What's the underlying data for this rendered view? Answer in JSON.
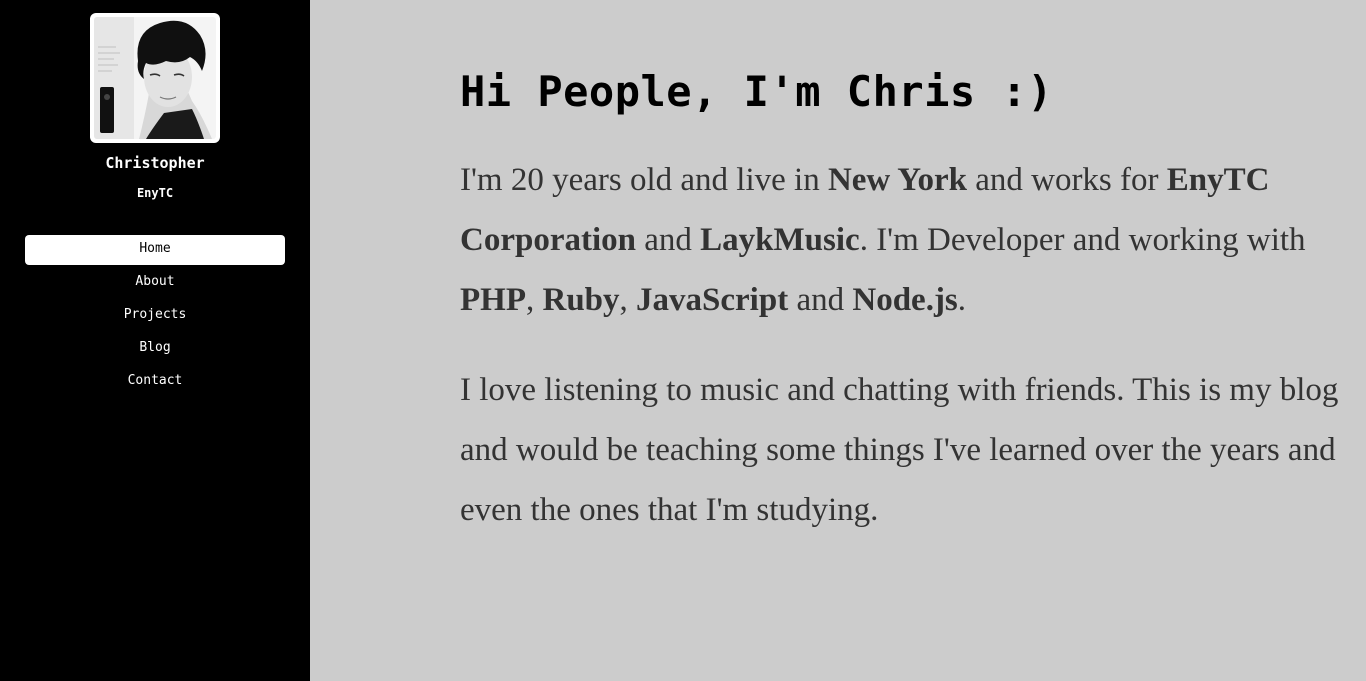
{
  "sidebar": {
    "avatar_alt": "profile-photo",
    "name": "Christopher",
    "company": "EnyTC",
    "nav": [
      {
        "label": "Home",
        "active": true
      },
      {
        "label": "About",
        "active": false
      },
      {
        "label": "Projects",
        "active": false
      },
      {
        "label": "Blog",
        "active": false
      },
      {
        "label": "Contact",
        "active": false
      }
    ]
  },
  "main": {
    "headline": "Hi People, I'm Chris :)",
    "intro": {
      "t1": "I'm 20 years old and live in ",
      "city": "New York",
      "t2": " and works for ",
      "company": "EnyTC Corporation",
      "t3": " and ",
      "company2": "LaykMusic",
      "t4": ". I'm Developer and working with ",
      "skill1": "PHP",
      "t5": ", ",
      "skill2": "Ruby",
      "t6": ", ",
      "skill3": "JavaScript",
      "t7": " and ",
      "skill4": "Node.js",
      "t8": "."
    },
    "paragraph2": "I love listening to music and chatting with friends. This is my blog and would be teaching some things I've learned over the years and even the ones that I'm studying."
  },
  "colors": {
    "sidebar_bg": "#000000",
    "page_bg": "#cccccc",
    "text": "#333333",
    "headline": "#000000"
  }
}
